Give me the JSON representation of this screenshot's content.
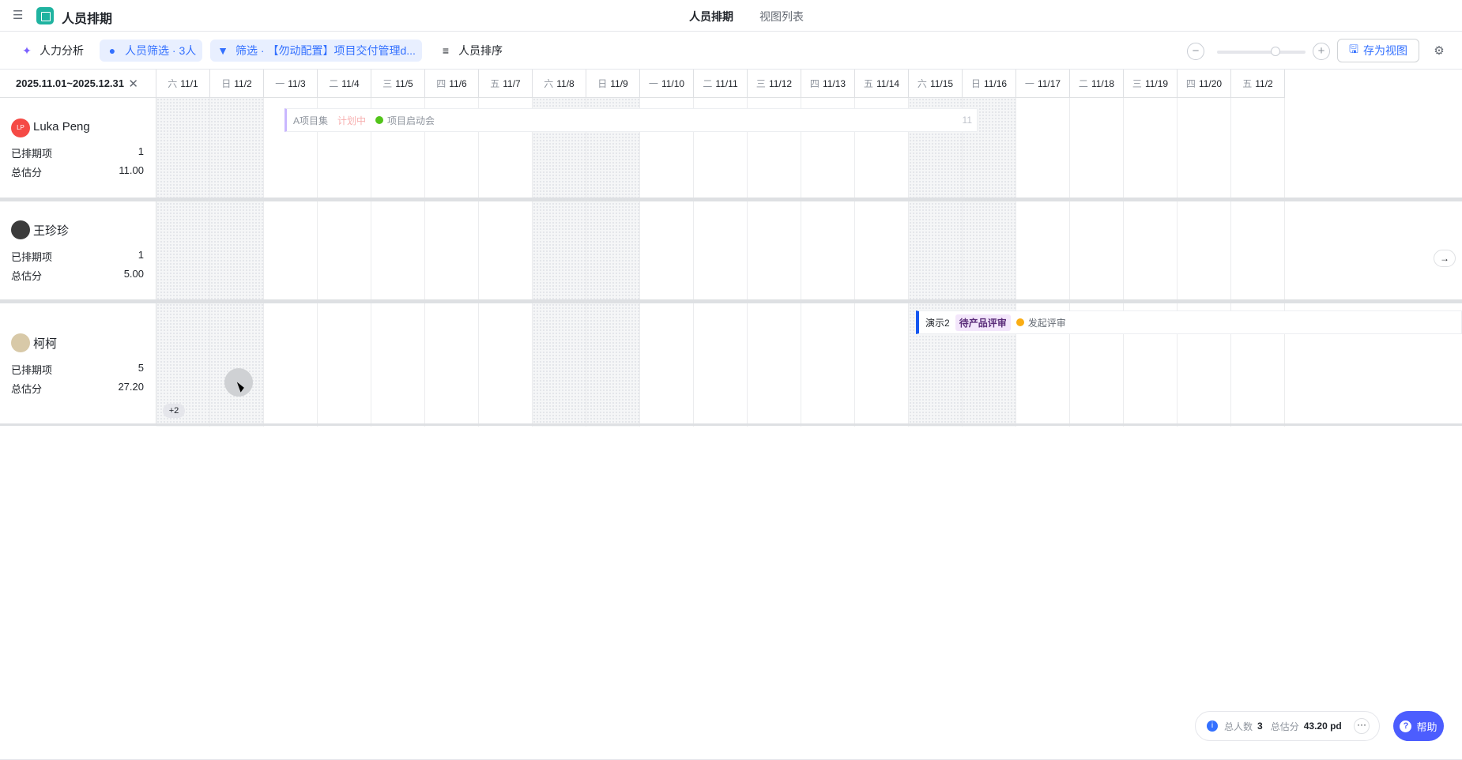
{
  "header": {
    "app_title": "人员排期",
    "tabs": [
      {
        "label": "人员排期",
        "active": true
      },
      {
        "label": "视图列表",
        "active": false
      }
    ]
  },
  "toolbar": {
    "analysis_label": "人力分析",
    "person_filter_label": "人员筛选 · 3人",
    "filter_label": "筛选 · 【勿动配置】项目交付管理d...",
    "sort_label": "人员排序",
    "save_view_label": "存为视图"
  },
  "range": {
    "label": "2025.11.01~2025.12.31"
  },
  "days": [
    {
      "wd": "六",
      "date": "11/1",
      "weekend": true
    },
    {
      "wd": "日",
      "date": "11/2",
      "weekend": true
    },
    {
      "wd": "一",
      "date": "11/3",
      "weekend": false
    },
    {
      "wd": "二",
      "date": "11/4",
      "weekend": false
    },
    {
      "wd": "三",
      "date": "11/5",
      "weekend": false
    },
    {
      "wd": "四",
      "date": "11/6",
      "weekend": false
    },
    {
      "wd": "五",
      "date": "11/7",
      "weekend": false
    },
    {
      "wd": "六",
      "date": "11/8",
      "weekend": true
    },
    {
      "wd": "日",
      "date": "11/9",
      "weekend": true
    },
    {
      "wd": "一",
      "date": "11/10",
      "weekend": false
    },
    {
      "wd": "二",
      "date": "11/11",
      "weekend": false
    },
    {
      "wd": "三",
      "date": "11/12",
      "weekend": false
    },
    {
      "wd": "四",
      "date": "11/13",
      "weekend": false
    },
    {
      "wd": "五",
      "date": "11/14",
      "weekend": false
    },
    {
      "wd": "六",
      "date": "11/15",
      "weekend": true
    },
    {
      "wd": "日",
      "date": "11/16",
      "weekend": true
    },
    {
      "wd": "一",
      "date": "11/17",
      "weekend": false
    },
    {
      "wd": "二",
      "date": "11/18",
      "weekend": false
    },
    {
      "wd": "三",
      "date": "11/19",
      "weekend": false
    },
    {
      "wd": "四",
      "date": "11/20",
      "weekend": false
    },
    {
      "wd": "五",
      "date": "11/2",
      "weekend": false
    }
  ],
  "people": [
    {
      "name": "Luka Peng",
      "avatar_text": "LP",
      "scheduled_label": "已排期项",
      "scheduled": "1",
      "estimate_label": "总估分",
      "estimate": "11.00",
      "avatar_color": "#f54a45"
    },
    {
      "name": "王珍珍",
      "scheduled_label": "已排期项",
      "scheduled": "1",
      "estimate_label": "总估分",
      "estimate": "5.00",
      "avatar_color": "#3b3b3b"
    },
    {
      "name": "柯柯",
      "scheduled_label": "已排期项",
      "scheduled": "5",
      "estimate_label": "总估分",
      "estimate": "27.20",
      "avatar_color": "#d8c9a8"
    }
  ],
  "tasks": [
    {
      "project": "A项目集",
      "status": "计划中",
      "step": "项目启动会",
      "estimate": "11",
      "bar_color": "#c9b7ff",
      "dot_color": "#52c41a"
    },
    {
      "project": "演示2",
      "status": "待产品评审",
      "step": "发起评审",
      "bar_color": "#1456f0",
      "dot_color": "#faad14"
    }
  ],
  "more_count": "+2",
  "footer": {
    "people_label": "总人数",
    "people_count": "3",
    "estimate_label": "总估分",
    "estimate_total": "43.20 pd",
    "help_label": "帮助"
  }
}
